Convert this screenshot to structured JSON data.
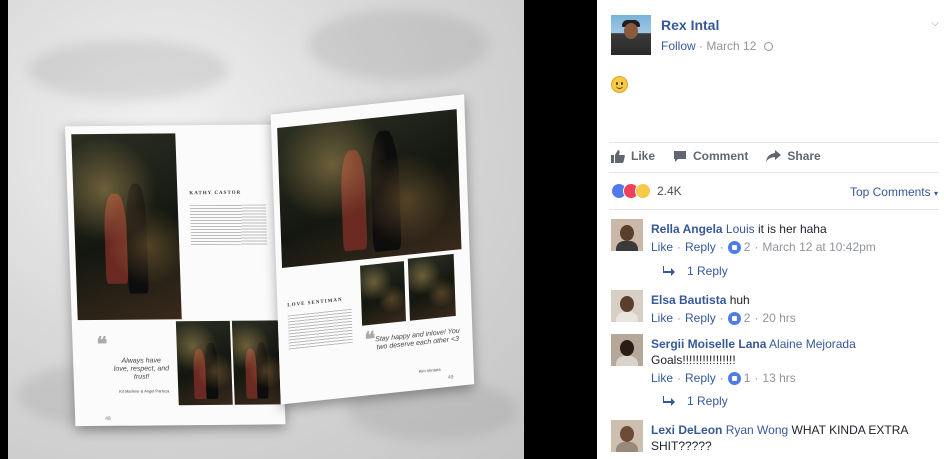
{
  "post": {
    "author": "Rex Intal",
    "follow_label": "Follow",
    "sep": "·",
    "date": "March 12",
    "privacy_icon": "globe-icon",
    "menu_icon": "chevron-down-icon",
    "body_emoji": "slightly-smiling-face-icon"
  },
  "photo": {
    "magazine": {
      "left_heading": "KATHY CASTOR",
      "right_heading": "LOVE SENTIMAN",
      "quote_left": "Always have love, respect, and trust!",
      "quote_left_author": "Kit Marlene & Angel Partoza",
      "quote_right": "Stay happy and inlove! You two deserve each other <3",
      "quote_right_author": "Kim Ventura",
      "page_left": "48",
      "page_right": "49"
    }
  },
  "actions": {
    "like": "Like",
    "comment": "Comment",
    "share": "Share"
  },
  "reactions": {
    "count": "2.4K",
    "types": [
      "like",
      "love",
      "wow"
    ],
    "top_comments": "Top Comments",
    "top_comments_caret": "▾"
  },
  "comment_labels": {
    "like": "Like",
    "reply": "Reply",
    "sep": "·"
  },
  "comments": [
    {
      "name": "Rella Angela",
      "tag": "Louis",
      "text": " it is her haha",
      "likes": "2",
      "time": "March 12 at 10:42pm",
      "replies": "1 Reply"
    },
    {
      "name": "Elsa Bautista",
      "tag": "",
      "text": " huh",
      "likes": "2",
      "time": "20 hrs",
      "replies": ""
    },
    {
      "name": "Sergii Moiselle Lana",
      "tag": "Alaine Mejorada",
      "text": "Goals!!!!!!!!!!!!!!!!",
      "likes": "1",
      "time": "13 hrs",
      "replies": "1 Reply"
    },
    {
      "name": "Lexi DeLeon",
      "tag": "Ryan Wong",
      "text": " WHAT KINDA EXTRA SHIT?????",
      "likes": "",
      "time": "",
      "replies": ""
    }
  ],
  "colors": {
    "link": "#365899",
    "meta": "#90949c",
    "like_blue": "#4f7ce8",
    "love_red": "#f0405a",
    "wow_yellow": "#f7c948"
  }
}
